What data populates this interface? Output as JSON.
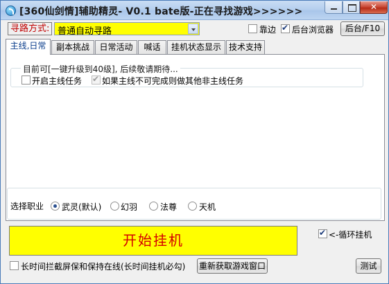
{
  "window": {
    "title": "[360仙剑情]辅助精灵- V0.1 bate版-正在寻找游戏>>>>>>"
  },
  "toolbar": {
    "path_label": "寻路方式:",
    "path_value": "普通自动寻路",
    "edge_label": "靠边",
    "edge_checked": false,
    "browser_label": "后台浏览器",
    "browser_checked": true,
    "background_button": "后台/F10"
  },
  "tabs": [
    {
      "label": "主线,日常",
      "active": true
    },
    {
      "label": "副本挑战",
      "active": false
    },
    {
      "label": "日常活动",
      "active": false
    },
    {
      "label": "喊话",
      "active": false
    },
    {
      "label": "挂机状态显示",
      "active": false
    },
    {
      "label": "技术支持",
      "active": false
    }
  ],
  "main_quest": {
    "group_title": "目前可[一键升级到40级], 后续敬请期待...",
    "enable_label": "开启主线任务",
    "enable_checked": false,
    "fallback_label": "如果主线不可完成则做其他非主线任务",
    "fallback_checked": true
  },
  "job": {
    "label": "选择职业",
    "options": [
      "武灵(默认)",
      "幻羽",
      "法尊",
      "天机"
    ],
    "selected": "武灵(默认)"
  },
  "start_button": "开始挂机",
  "loop": {
    "label": "<-循环挂机",
    "checked": true
  },
  "bottom": {
    "keepalive_label": "长时间拦截屏保和保持在线(长时间挂机必勾)",
    "keepalive_checked": false,
    "refresh_button": "重新获取游戏窗口",
    "test_button": "测试"
  },
  "icons": [
    "app-logo-icon",
    "minimize-icon",
    "maximize-icon",
    "close-icon",
    "dropdown-arrow-icon"
  ]
}
